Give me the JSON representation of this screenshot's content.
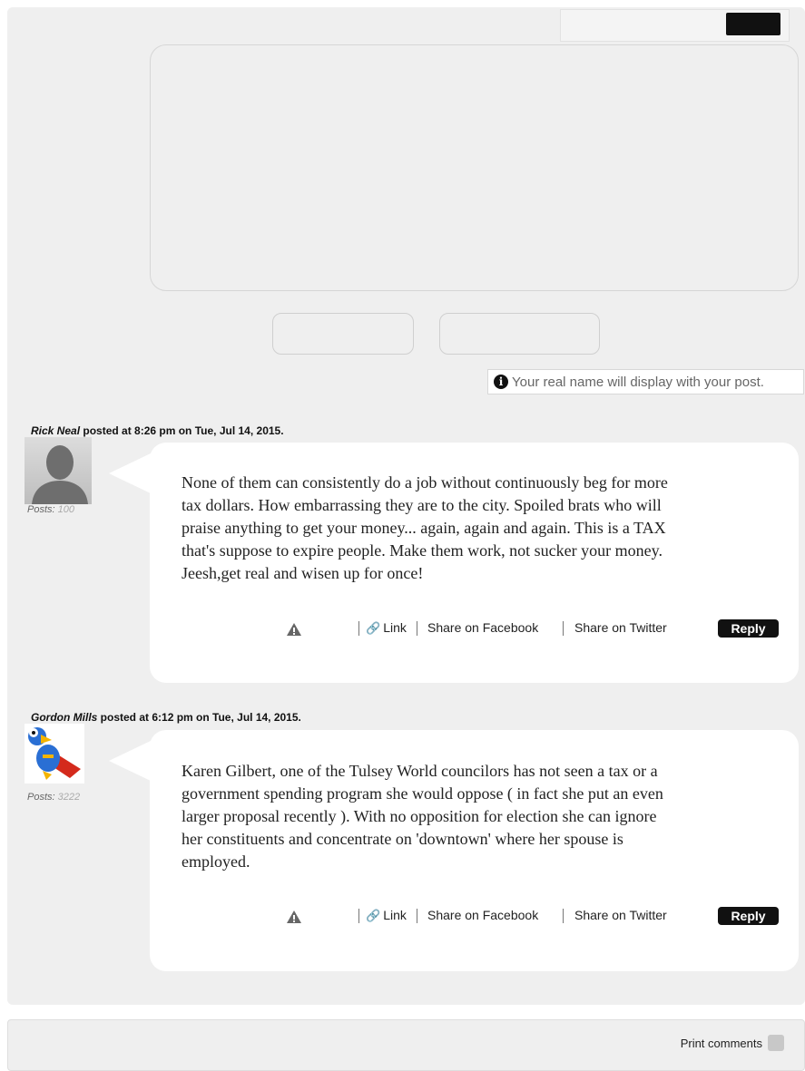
{
  "form": {
    "notice": "Your real name will display with your post."
  },
  "comments": [
    {
      "author": "Rick Neal",
      "meta": " posted at 8:26 pm on Tue, Jul 14, 2015.",
      "posts_label": "Posts:",
      "posts_count": "100",
      "lines": [
        "None of them can consistently do a job without continuously beg for more",
        "tax dollars. How embarrassing they are to the city. Spoiled brats who will",
        "praise anything to get your money... again, again and again. This is a TAX",
        "that's suppose to expire people. Make them work, not sucker your money.",
        "Jeesh,get real and wisen up for once!"
      ],
      "avatar_icon": "silhouette-avatar"
    },
    {
      "author": "Gordon Mills",
      "meta": " posted at 6:12 pm on Tue, Jul 14, 2015.",
      "posts_label": "Posts:",
      "posts_count": "3222",
      "lines": [
        "Karen Gilbert, one of the Tulsey World councilors has not seen a tax or a",
        "government spending program she would oppose ( in fact she put an even",
        "larger proposal recently ). With no opposition for election she can ignore",
        "her constituents and concentrate on 'downtown' where her spouse is",
        "employed."
      ],
      "avatar_icon": "superhero-bird-avatar"
    }
  ],
  "actions": {
    "link": "Link",
    "facebook": "Share on Facebook",
    "twitter": "Share on Twitter",
    "reply": "Reply"
  },
  "footer": {
    "print": "Print comments"
  }
}
